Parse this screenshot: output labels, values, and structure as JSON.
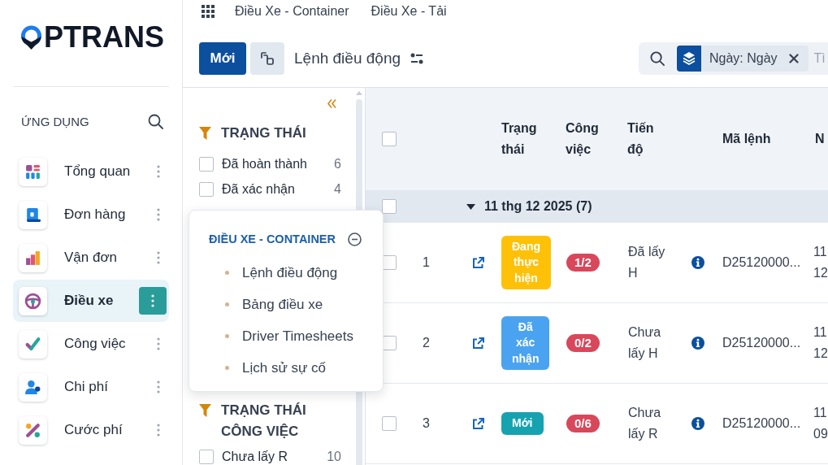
{
  "logo": {
    "text": "PTRANS"
  },
  "sidebar": {
    "heading": "ỨNG DỤNG",
    "items": [
      {
        "label": "Tổng quan",
        "kind": "dashboard",
        "selected": false
      },
      {
        "label": "Đơn hàng",
        "kind": "orders",
        "selected": false
      },
      {
        "label": "Vận đơn",
        "kind": "waybill",
        "selected": false
      },
      {
        "label": "Điều xe",
        "kind": "dispatch",
        "selected": true
      },
      {
        "label": "Công việc",
        "kind": "tasks",
        "selected": false
      },
      {
        "label": "Chi phí",
        "kind": "costs",
        "selected": false
      },
      {
        "label": "Cước phí",
        "kind": "fees",
        "selected": false
      }
    ]
  },
  "top_nav": {
    "items": [
      {
        "label": "Điều Xe - Container"
      },
      {
        "label": "Điều Xe - Tải"
      }
    ]
  },
  "toolbar": {
    "new_button": "Mới",
    "title": "Lệnh điều động"
  },
  "search": {
    "facet": "Ngày: Ngày",
    "placeholder": "Tì"
  },
  "filter_panel": {
    "groups": [
      {
        "title": "TRẠNG THÁI",
        "items": [
          {
            "label": "Đã hoàn thành",
            "count": "6",
            "checked": false
          },
          {
            "label": "Đã xác nhận",
            "count": "4",
            "checked": false
          }
        ]
      },
      {
        "title": "TRẠNG THÁI CÔNG VIỆC",
        "items": [
          {
            "label": "Chưa lấy R",
            "count": "10",
            "checked": false
          }
        ]
      }
    ]
  },
  "app_menu": {
    "title": "ĐIỀU XE - CONTAINER",
    "items": [
      "Lệnh điều động",
      "Bảng điều xe",
      "Driver Timesheets",
      "Lịch sử sự cố"
    ]
  },
  "table": {
    "select_all": {
      "checked": false
    },
    "columns": [
      "Trạng thái",
      "Công việc",
      "Tiến độ",
      "Mã lệnh",
      "N"
    ],
    "group": {
      "label": "11 thg 12 2025 (7)",
      "expanded": true,
      "checked": false
    },
    "rows": [
      {
        "checked": false,
        "number": "1",
        "status": {
          "label": "Đang thực hiện",
          "color": "#ffc107"
        },
        "tasks": "1/2",
        "progress": "Đã lấy H",
        "code": "D25120000...",
        "column_9": "11 12"
      },
      {
        "checked": false,
        "number": "2",
        "status": {
          "label": "Đã xác nhận",
          "color": "#4aa3f0"
        },
        "tasks": "0/2",
        "progress": "Chưa lấy H",
        "code": "D25120000...",
        "column_9": "11 12"
      },
      {
        "checked": false,
        "number": "3",
        "status": {
          "label": "Mới",
          "color": "#17a2b0"
        },
        "tasks": "0/6",
        "progress": "Chưa lấy R",
        "code": "D25120000...",
        "column_9": "11 09"
      }
    ]
  }
}
